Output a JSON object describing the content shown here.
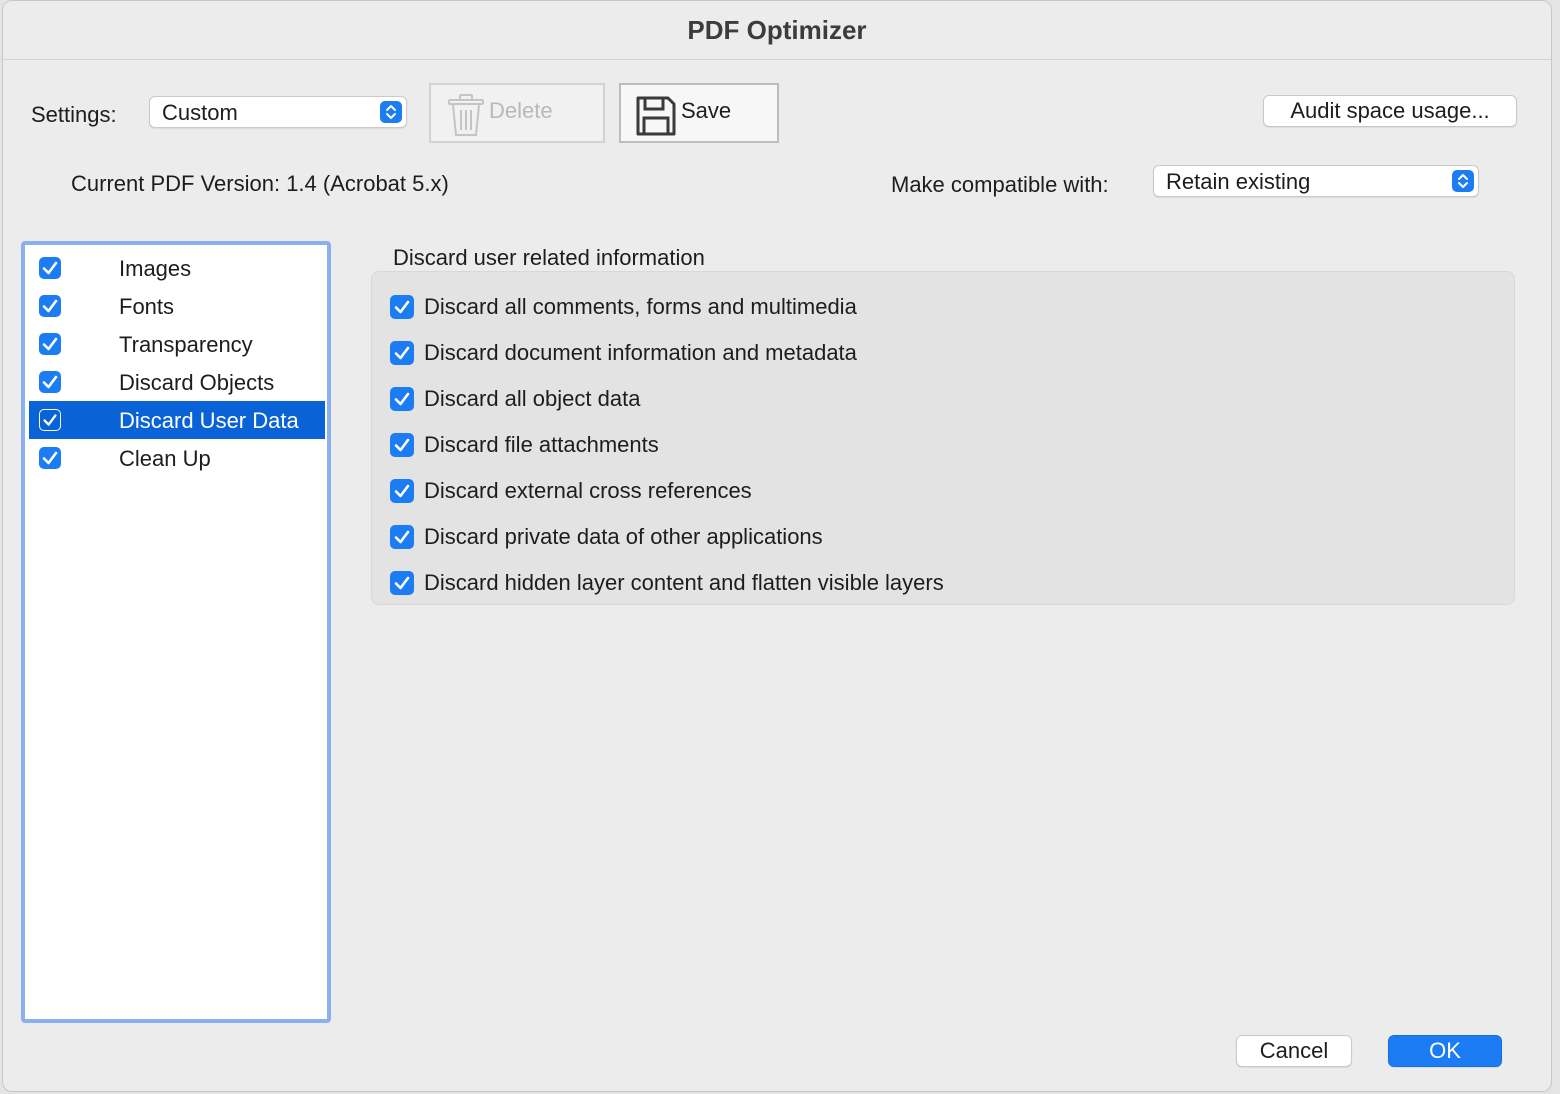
{
  "window": {
    "title": "PDF Optimizer"
  },
  "toolbar": {
    "settings_label": "Settings:",
    "settings_value": "Custom",
    "delete_label": "Delete",
    "save_label": "Save",
    "audit_label": "Audit space usage..."
  },
  "version": {
    "current_text": "Current PDF Version: 1.4 (Acrobat 5.x)",
    "compat_label": "Make compatible with:",
    "compat_value": "Retain existing"
  },
  "sidebar": {
    "items": [
      {
        "label": "Images",
        "checked": true,
        "selected": false
      },
      {
        "label": "Fonts",
        "checked": true,
        "selected": false
      },
      {
        "label": "Transparency",
        "checked": true,
        "selected": false
      },
      {
        "label": "Discard Objects",
        "checked": true,
        "selected": false
      },
      {
        "label": "Discard User Data",
        "checked": true,
        "selected": true
      },
      {
        "label": "Clean Up",
        "checked": true,
        "selected": false
      }
    ]
  },
  "panel": {
    "heading": "Discard user related information",
    "options": [
      {
        "label": "Discard all comments, forms and multimedia",
        "checked": true
      },
      {
        "label": "Discard document information and metadata",
        "checked": true
      },
      {
        "label": "Discard all object data",
        "checked": true
      },
      {
        "label": "Discard file attachments",
        "checked": true
      },
      {
        "label": "Discard external cross references",
        "checked": true
      },
      {
        "label": "Discard private data of other applications",
        "checked": true
      },
      {
        "label": "Discard hidden layer content and flatten visible layers",
        "checked": true
      }
    ]
  },
  "footer": {
    "cancel_label": "Cancel",
    "ok_label": "OK"
  },
  "colors": {
    "accent": "#1c7cf4",
    "selection": "#0a63d6",
    "sidebar_border": "#8ab0ef"
  }
}
